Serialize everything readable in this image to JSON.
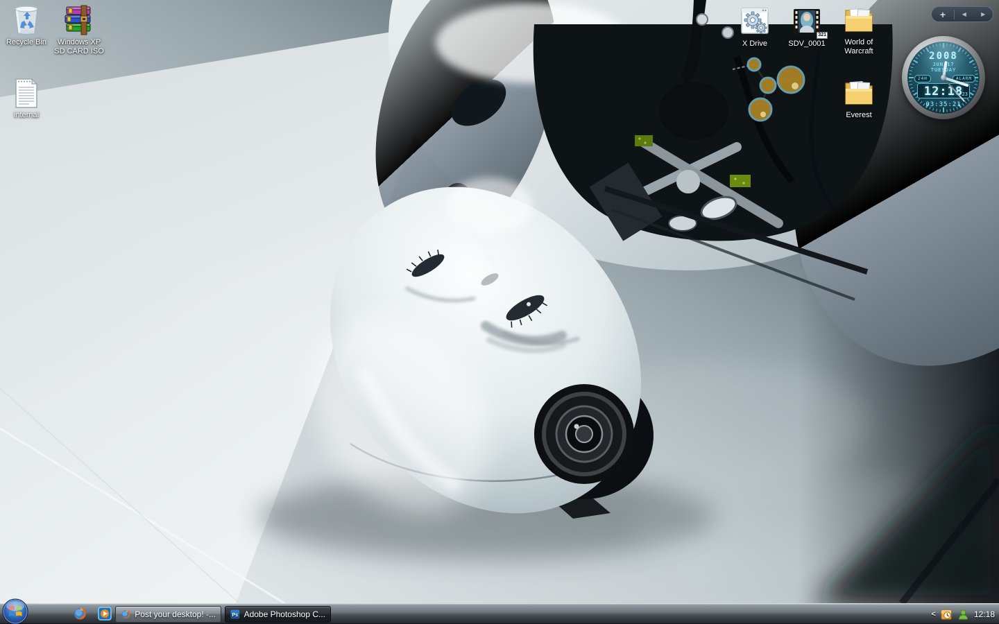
{
  "desktop": {
    "icons": [
      {
        "label": "Recycle Bin",
        "icon": "recycle-bin-icon"
      },
      {
        "label": "Windows XP\nSD CARD ISO",
        "icon": "winrar-archive-icon"
      },
      {
        "label": "internal",
        "icon": "text-document-icon"
      },
      {
        "label": "X Drive",
        "icon": "app-gears-icon"
      },
      {
        "label": "SDV_0001",
        "icon": "video-thumbnail-icon",
        "badge": "321"
      },
      {
        "label": "World of\nWarcraft",
        "icon": "folder-icon"
      },
      {
        "label": "Everest",
        "icon": "folder-icon"
      }
    ]
  },
  "gadgets": {
    "sidebar_controls": {
      "add_label": "+",
      "prev_label": "◀",
      "next_label": "▶"
    },
    "clock": {
      "year": "2008",
      "date": "JUN 17",
      "weekday": "TUESDAY",
      "mode_label": "24H",
      "alarm_label": "ALARM",
      "time": "12:18",
      "seconds": "23",
      "alarm_time": "03:35:21",
      "accent_color": "#8fdcf0"
    }
  },
  "taskbar": {
    "start_label": "Start",
    "quick_launch": [
      {
        "icon": "firefox-icon"
      },
      {
        "icon": "windows-media-player-icon"
      }
    ],
    "buttons": [
      {
        "label": "Post your desktop! -...",
        "icon": "firefox-icon",
        "icon_text": "",
        "active": false
      },
      {
        "label": "Adobe Photoshop C...",
        "icon": "photoshop-icon",
        "icon_text": "Ps",
        "active": true
      }
    ],
    "tray": {
      "chevron": "<",
      "icons": [
        "reminder-clock-icon",
        "messenger-buddy-icon"
      ],
      "clock": "12:18"
    }
  }
}
